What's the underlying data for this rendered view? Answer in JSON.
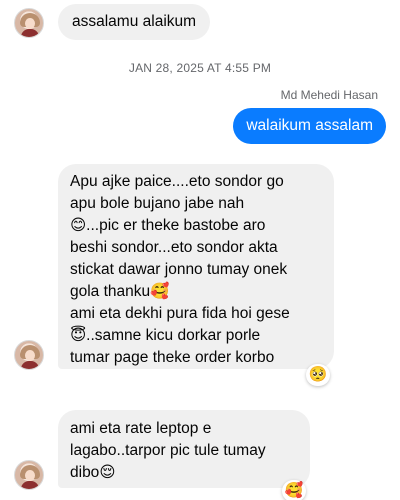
{
  "messages": {
    "m1": {
      "text": "assalamu alaikum"
    },
    "timestamp": "JAN 28, 2025 AT 4:55 PM",
    "sender_name": "Md Mehedi Hasan",
    "m2": {
      "text": "walaikum assalam"
    },
    "m3": {
      "text": "Apu ajke paice....eto sondor go\napu bole bujano jabe nah\n😊...pic er theke bastobe aro\nbeshi sondor...eto sondor akta\nstickat dawar jonno tumay onek\ngola thanku🥰\nami eta dekhi pura fida hoi gese\n😇..samne kicu dorkar porle\ntumar page theke order korbo",
      "reaction": "🥺"
    },
    "m4": {
      "text": "ami eta rate leptop e\nlagabo..tarpor pic tule tumay\ndibo😌",
      "reaction": "🥰"
    }
  },
  "colors": {
    "outgoing_bubble": "#0a7cff",
    "incoming_bubble": "#f0f0f0",
    "meta_text": "#65676b"
  },
  "icons": {
    "avatar": "contact-avatar"
  }
}
